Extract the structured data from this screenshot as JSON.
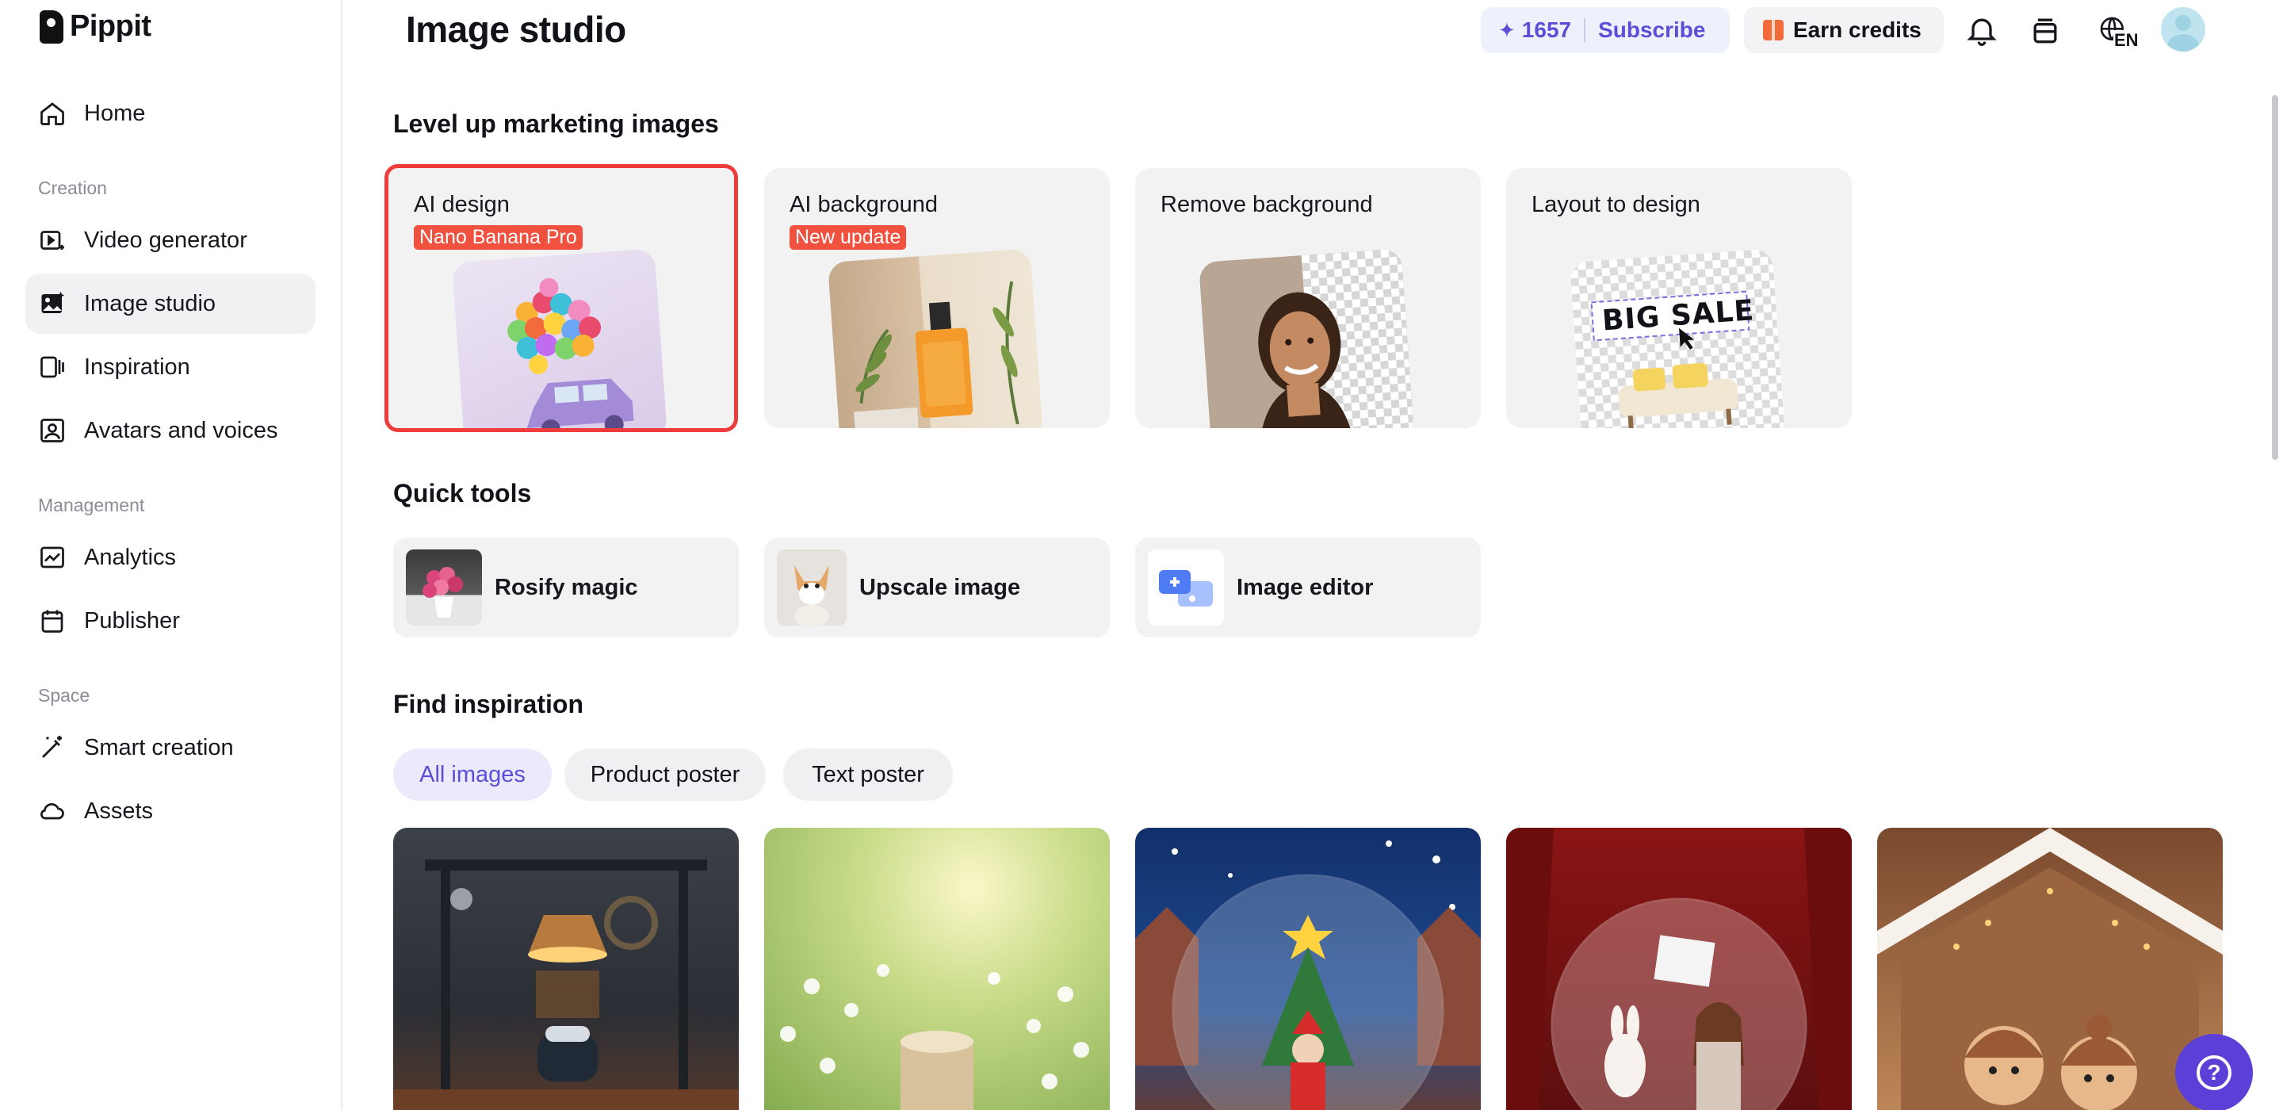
{
  "app": {
    "logo_text": "Pippit"
  },
  "sidebar": {
    "items_top": [
      {
        "label": "Home",
        "icon": "home-icon"
      }
    ],
    "sections": [
      {
        "label": "Creation"
      },
      {
        "label": "Management"
      },
      {
        "label": "Space"
      }
    ],
    "creation": [
      {
        "label": "Video generator",
        "icon": "video-generator-icon"
      },
      {
        "label": "Image studio",
        "icon": "image-studio-icon",
        "active": true
      },
      {
        "label": "Inspiration",
        "icon": "inspiration-icon"
      },
      {
        "label": "Avatars and voices",
        "icon": "avatar-icon"
      }
    ],
    "management": [
      {
        "label": "Analytics",
        "icon": "analytics-icon"
      },
      {
        "label": "Publisher",
        "icon": "calendar-icon"
      }
    ],
    "space": [
      {
        "label": "Smart creation",
        "icon": "magic-wand-icon"
      },
      {
        "label": "Assets",
        "icon": "cloud-icon"
      }
    ]
  },
  "header": {
    "title": "Image studio",
    "credits_value": "1657",
    "subscribe_label": "Subscribe",
    "earn_label": "Earn credits",
    "language": "EN"
  },
  "sections": {
    "marketing_title": "Level up marketing images",
    "quick_title": "Quick tools",
    "inspiration_title": "Find inspiration"
  },
  "feature_cards": [
    {
      "label": "AI design",
      "badge": "Nano Banana Pro",
      "selected": true
    },
    {
      "label": "AI background",
      "badge": "New update"
    },
    {
      "label": "Remove background"
    },
    {
      "label": "Layout to design",
      "thumb_text": "BIG SALE"
    }
  ],
  "quick_tools": [
    {
      "label": "Rosify magic"
    },
    {
      "label": "Upscale image"
    },
    {
      "label": "Image editor"
    }
  ],
  "filters": [
    {
      "label": "All images",
      "active": true
    },
    {
      "label": "Product poster"
    },
    {
      "label": "Text poster"
    }
  ],
  "colors": {
    "accent": "#5a4fd6",
    "badge": "#f0523f",
    "selected_outline": "#ee3b3b"
  }
}
